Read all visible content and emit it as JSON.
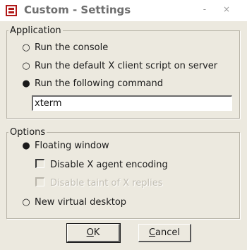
{
  "window": {
    "title": "Custom - Settings",
    "controls": "- ×"
  },
  "application": {
    "legend": "Application",
    "options": [
      {
        "label": "Run the console",
        "selected": false
      },
      {
        "label": "Run the default X client script on server",
        "selected": false
      },
      {
        "label": "Run the following command",
        "selected": true
      }
    ],
    "command_value": "xterm"
  },
  "options_group": {
    "legend": "Options",
    "floating_window": "Floating window",
    "disable_x_agent_encoding": "Disable X agent encoding",
    "disable_taint_x_replies": "Disable taint of X replies",
    "new_virtual_desktop": "New virtual desktop"
  },
  "buttons": {
    "ok_mnemonic": "O",
    "ok_rest": "K",
    "cancel_mnemonic": "C",
    "cancel_rest": "ancel"
  },
  "glyphs": {
    "radio_off": "○",
    "radio_on": "●"
  },
  "colors": {
    "dialog_bg": "#ece9df",
    "icon_red": "#b01818"
  }
}
